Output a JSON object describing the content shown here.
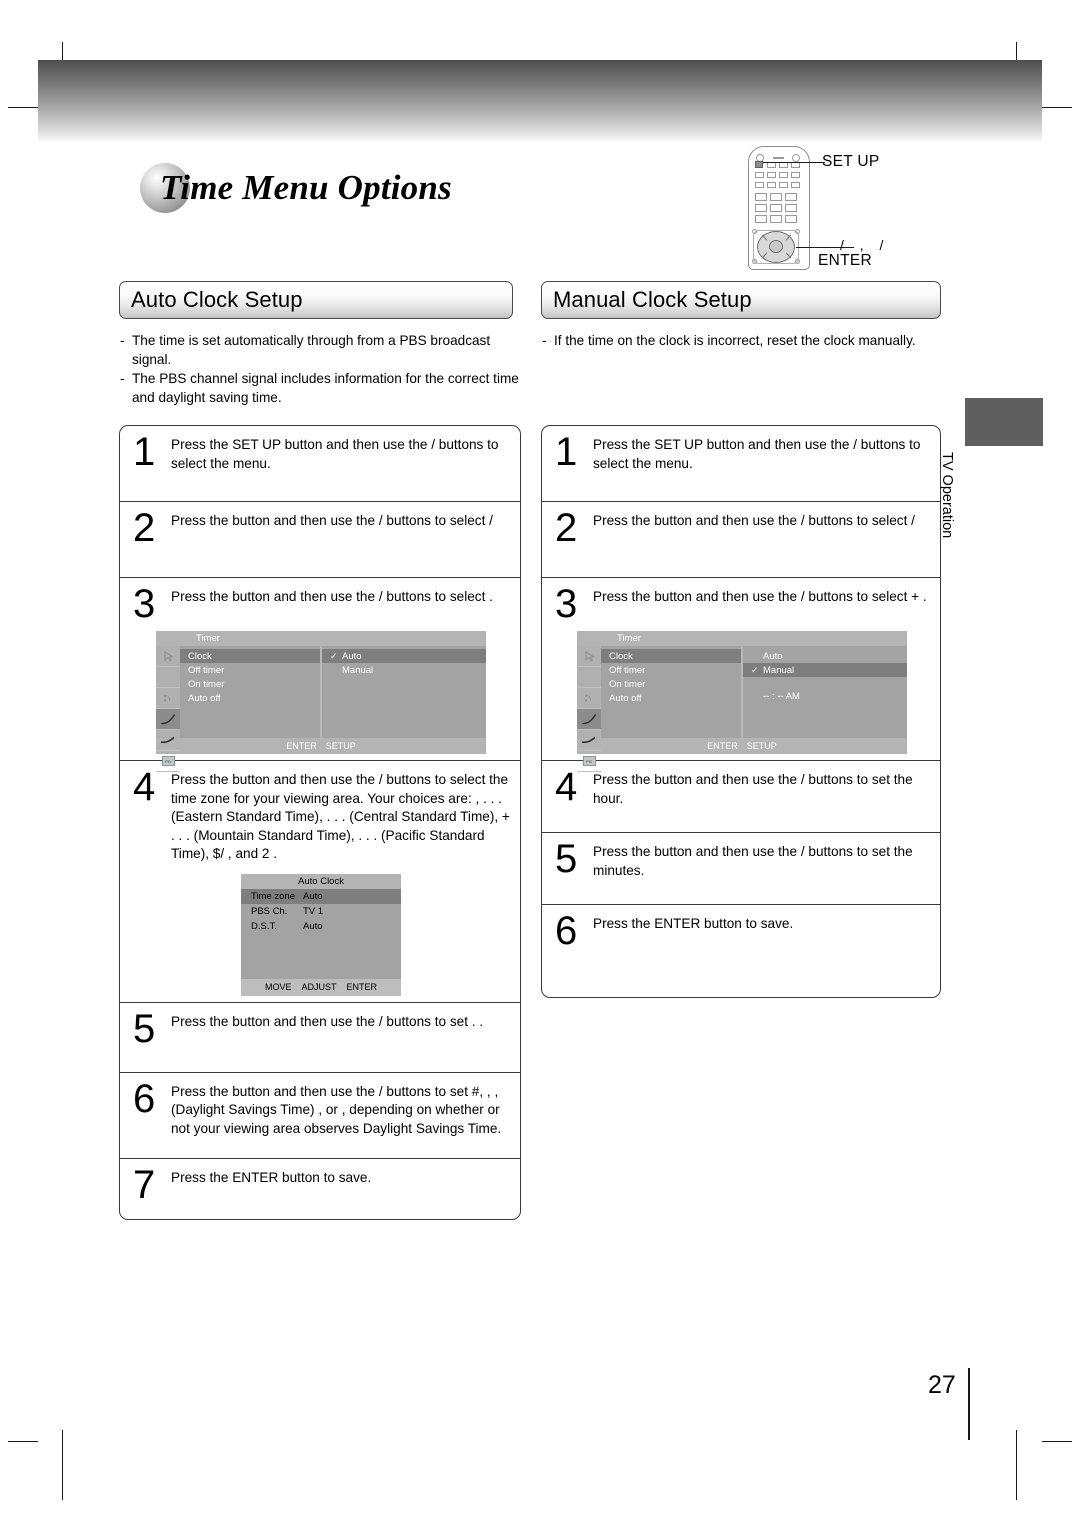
{
  "page": {
    "title": "Time Menu Options",
    "number": "27",
    "side_tab_label": "TV Operation"
  },
  "remote": {
    "setup_label": "SET UP",
    "enter_label": "ENTER",
    "arrows_label": "/ , /"
  },
  "left_column": {
    "header": "Auto Clock Setup",
    "bullets": [
      "The time is set automatically through from a PBS broadcast signal.",
      "The PBS channel signal includes information for the correct time and daylight saving time."
    ],
    "steps": [
      {
        "num": "1",
        "text": "Press the SET UP button and then use the  /  buttons to select the         menu."
      },
      {
        "num": "2",
        "text": "Press the        button and then use the  /  buttons to select   /"
      },
      {
        "num": "3",
        "text": "Press the        button and then use the  /  buttons to select        ."
      },
      {
        "num": "4",
        "text": "Press the       button and then use the  /  buttons to select the time zone for your viewing area. Your choices are:          ,  . . . (Eastern Standard Time),   . . . (Central Standard Time), + . . . (Mountain Standard Time),   . . . (Pacific Standard Time),   $/      , and   2       ."
      },
      {
        "num": "5",
        "text": "Press the       button and then use the  /  buttons to set .              ."
      },
      {
        "num": "6",
        "text": "Press the       button and then use the  /  buttons to set #, , ,  (Daylight Savings Time)        ,     or     , depending on whether or not your viewing area observes Daylight Savings Time."
      },
      {
        "num": "7",
        "text": "Press the ENTER button to save."
      }
    ]
  },
  "right_column": {
    "header": "Manual Clock Setup",
    "bullets": [
      "If the time on the clock is incorrect, reset the clock manually."
    ],
    "steps": [
      {
        "num": "1",
        "text": "Press the SET UP button and then use the  /  buttons to select the         menu."
      },
      {
        "num": "2",
        "text": "Press the        button and then use the  /  buttons to select   /"
      },
      {
        "num": "3",
        "text": "Press the        button and then use the  /  buttons to select +        ."
      },
      {
        "num": "4",
        "text": "Press the       button and then use the  /  buttons to set the hour."
      },
      {
        "num": "5",
        "text": "Press the       button and then use the  /  buttons to set the minutes."
      },
      {
        "num": "6",
        "text": "Press the ENTER button to save."
      }
    ]
  },
  "osd_auto": {
    "title": "Timer",
    "menu_items": [
      "Clock",
      "Off timer",
      "On timer",
      "Auto off"
    ],
    "selected_menu_item": "Clock",
    "options": [
      {
        "label": "Auto",
        "checked": "✓",
        "selected": true
      },
      {
        "label": "Manual",
        "checked": "",
        "selected": false
      }
    ],
    "footer": [
      "ENTER",
      "SETUP"
    ]
  },
  "osd_manual": {
    "title": "Timer",
    "menu_items": [
      "Clock",
      "Off timer",
      "On timer",
      "Auto off"
    ],
    "selected_menu_item": "Clock",
    "options": [
      {
        "label": "Auto",
        "checked": "",
        "selected": false
      },
      {
        "label": "Manual",
        "checked": "✓",
        "selected": true
      }
    ],
    "time_display": "-- : --   AM",
    "footer": [
      "ENTER",
      "SETUP"
    ]
  },
  "osd_auto_clock": {
    "title": "Auto Clock",
    "rows": [
      {
        "key": "Time zone",
        "value": "Auto",
        "selected": true
      },
      {
        "key": "PBS Ch.",
        "value": "TV 1",
        "selected": false
      },
      {
        "key": "D.S.T.",
        "value": "Auto",
        "selected": false
      }
    ],
    "footer": [
      "MOVE",
      "ADJUST",
      "ENTER"
    ]
  },
  "colors": {
    "osd_bg": "#a3a3a3",
    "osd_highlight": "#7e7e7e",
    "osd_bar": "#b4b4b4",
    "tab": "#5f5f5f"
  }
}
